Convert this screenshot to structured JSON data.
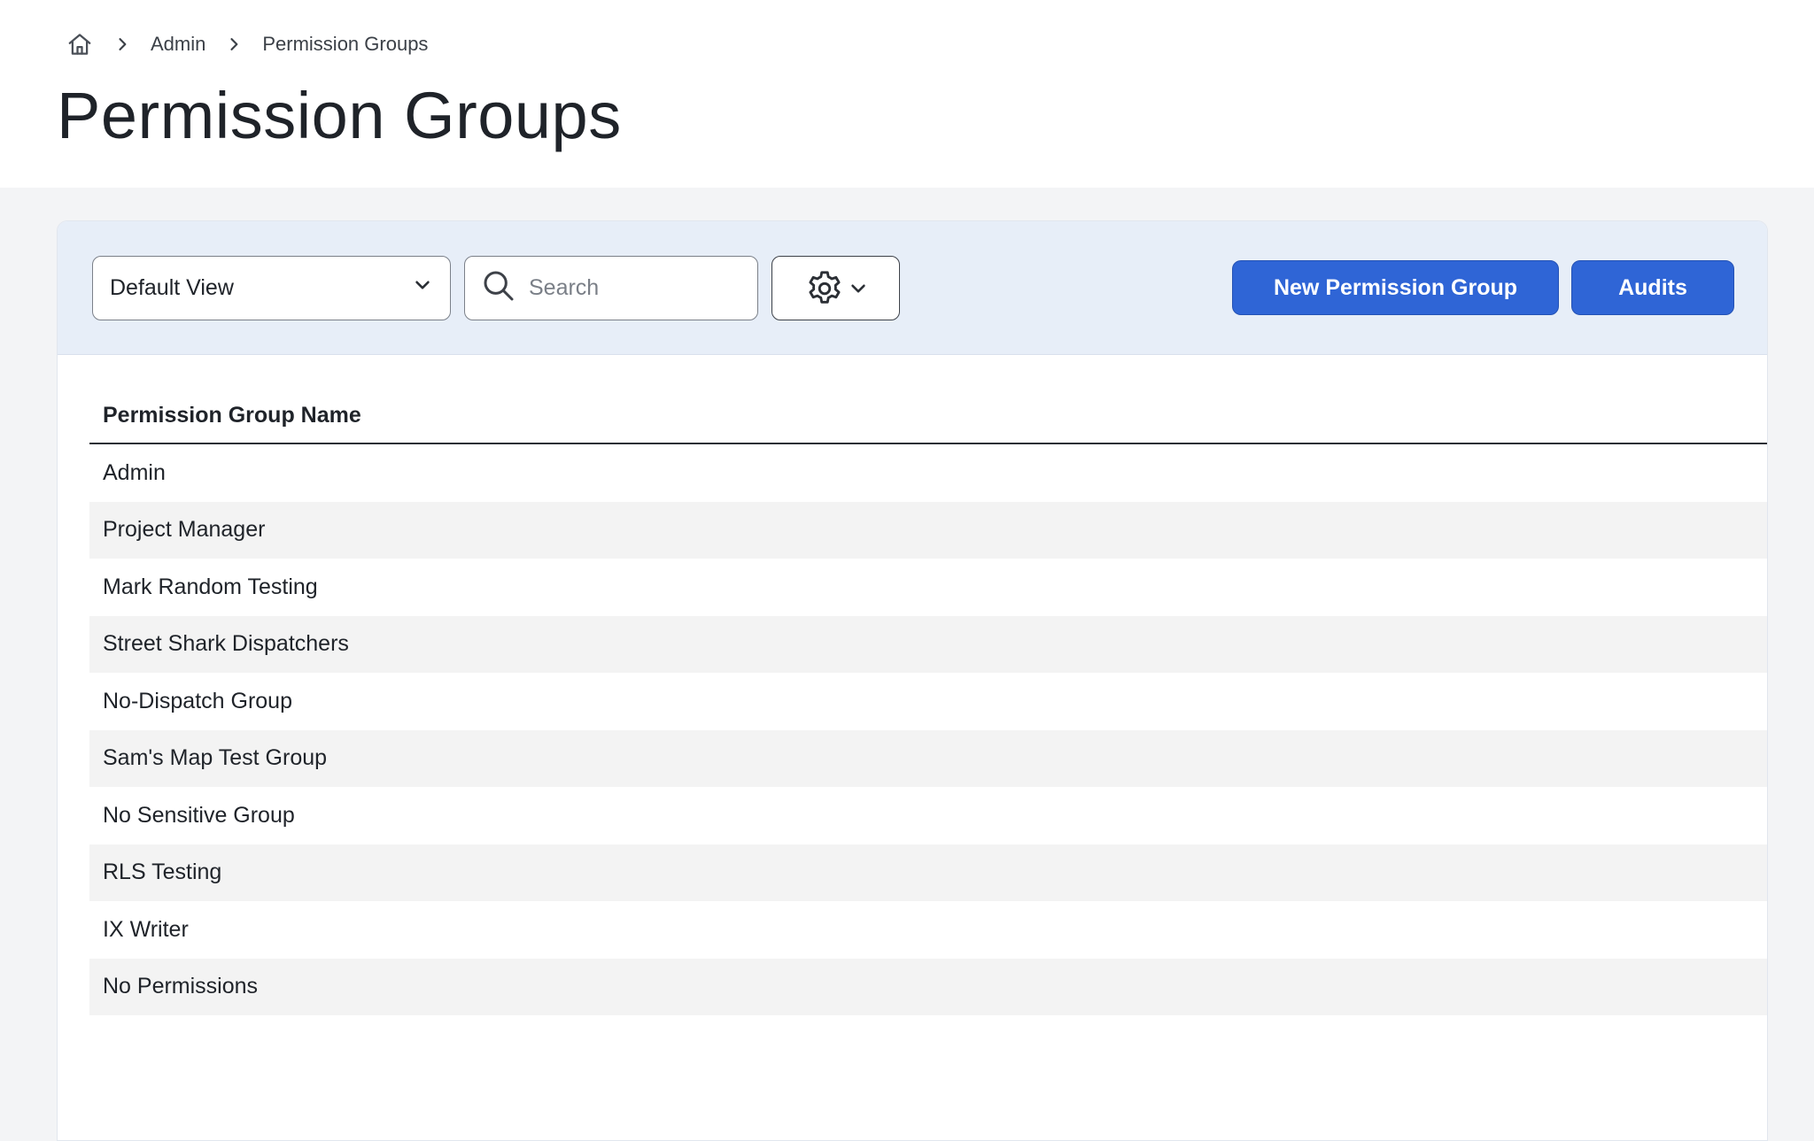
{
  "breadcrumb": {
    "home_icon": "home-icon",
    "separator_icon": "chevron-right-icon",
    "items": [
      "Admin",
      "Permission Groups"
    ]
  },
  "page": {
    "title": "Permission Groups"
  },
  "toolbar": {
    "view_select": {
      "value": "Default View",
      "icon": "chevron-down-icon"
    },
    "search": {
      "placeholder": "Search",
      "value": "",
      "icon": "search-icon"
    },
    "settings": {
      "icon": "gear-icon",
      "dropdown_icon": "chevron-down-icon"
    },
    "new_button_label": "New Permission Group",
    "audits_button_label": "Audits"
  },
  "table": {
    "columns": [
      "Permission Group Name"
    ],
    "rows": [
      "Admin",
      "Project Manager",
      "Mark Random Testing",
      "Street Shark Dispatchers",
      "No-Dispatch Group",
      "Sam's Map Test Group",
      "No Sensitive Group",
      "RLS Testing",
      "IX Writer",
      "No Permissions"
    ]
  },
  "colors": {
    "primary": "#2f65d6",
    "toolbar_bg": "#e7eef8",
    "page_bg": "#f3f4f6",
    "row_stripe": "#f3f3f3"
  }
}
